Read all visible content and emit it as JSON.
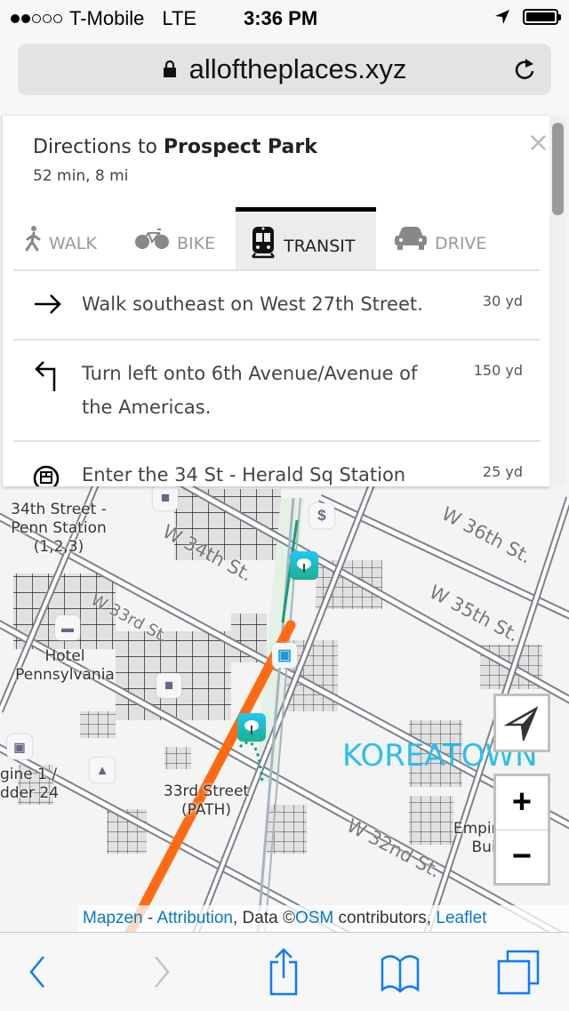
{
  "status_bar": {
    "signal_bars_filled": 2,
    "signal_bars_total": 5,
    "carrier": "T-Mobile",
    "network": "LTE",
    "time": "3:36 PM",
    "location_icon": "location-arrow-icon",
    "battery_icon": "battery-full-icon"
  },
  "browser": {
    "url": "alloftheplaces.xyz",
    "secure_icon": "lock-icon",
    "reload_icon": "reload-icon"
  },
  "directions": {
    "title_prefix": "Directions to ",
    "destination": "Prospect Park",
    "summary": "52 min, 8 mi",
    "close_label": "×",
    "tabs": [
      {
        "label": "WALK",
        "icon": "walk-icon",
        "active": false
      },
      {
        "label": "BIKE",
        "icon": "bike-icon",
        "active": false
      },
      {
        "label": "TRANSIT",
        "icon": "train-icon",
        "active": true
      },
      {
        "label": "DRIVE",
        "icon": "car-icon",
        "active": false
      }
    ],
    "steps": [
      {
        "icon": "arrow-right-icon",
        "text": "Walk southeast on West 27th Street.",
        "distance": "30 yd"
      },
      {
        "icon": "turn-left-icon",
        "text": "Turn left onto 6th Avenue/Avenue of the Americas.",
        "distance": "150 yd"
      },
      {
        "icon": "subway-icon",
        "text": "Enter the 34 St - Herald Sq Station",
        "distance": "25 yd"
      }
    ]
  },
  "map": {
    "route_color": "#ff6a13",
    "labels": {
      "penn_station": "34th Street -\nPenn Station\n(1,2,3)",
      "hotel": "Hotel\nPennsylvania",
      "engine": "gine 1 /\ndder 24",
      "path_station": "33rd Street\n(PATH)",
      "empire": "Empire State\nBuilding",
      "neighborhood": "KOREATOWN"
    },
    "streets": [
      "W 36th St.",
      "W 35th St.",
      "W 34th St.",
      "W 33rd St.",
      "W 32nd St."
    ],
    "controls": {
      "locate_icon": "locate-arrow-icon",
      "zoom_in": "+",
      "zoom_out": "−"
    },
    "attribution": {
      "mapzen": "Mapzen",
      "sep1": " - ",
      "attribution": "Attribution",
      "data": ", Data ©",
      "osm": "OSM",
      "contrib": " contributors, ",
      "leaflet": "Leaflet"
    }
  },
  "toolbar": {
    "back_icon": "back-chevron-icon",
    "forward_icon": "forward-chevron-icon",
    "share_icon": "share-icon",
    "bookmarks_icon": "bookmarks-icon",
    "tabs_icon": "tabs-icon"
  }
}
